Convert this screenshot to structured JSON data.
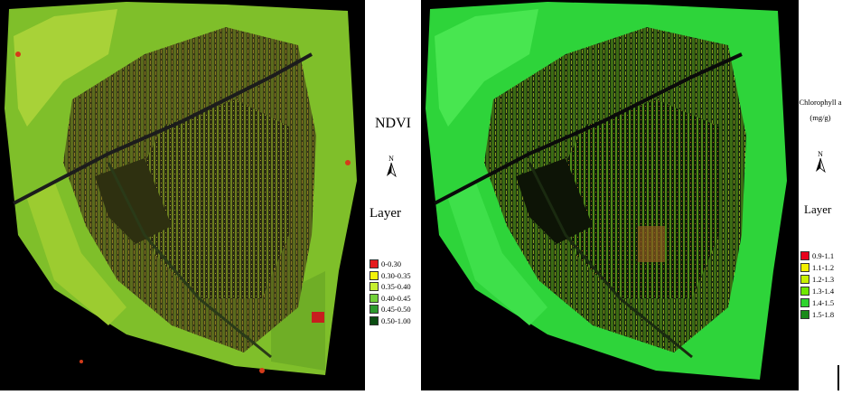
{
  "left_map": {
    "title": "NDVI",
    "layer_label": "Layer",
    "north_label": "N",
    "legend": [
      {
        "label": "0-0.30",
        "color": "#e41a1c"
      },
      {
        "label": "0.30-0.35",
        "color": "#f2f20a"
      },
      {
        "label": "0.35-0.40",
        "color": "#c6ef2e"
      },
      {
        "label": "0.40-0.45",
        "color": "#73d13a"
      },
      {
        "label": "0.45-0.50",
        "color": "#2e9b2e"
      },
      {
        "label": "0.50-1.00",
        "color": "#0b4d12"
      }
    ]
  },
  "right_map": {
    "title_line1": "Chlorophyll a",
    "title_line2": "(mg/g)",
    "layer_label": "Layer",
    "north_label": "N",
    "legend": [
      {
        "label": "0.9-1.1",
        "color": "#e8001c"
      },
      {
        "label": "1.1-1.2",
        "color": "#f2f000"
      },
      {
        "label": "1.2-1.3",
        "color": "#c8f000"
      },
      {
        "label": "1.3-1.4",
        "color": "#6fe800"
      },
      {
        "label": "1.4-1.5",
        "color": "#2fd42f"
      },
      {
        "label": "1.5-1.8",
        "color": "#1a8a1a"
      }
    ]
  }
}
